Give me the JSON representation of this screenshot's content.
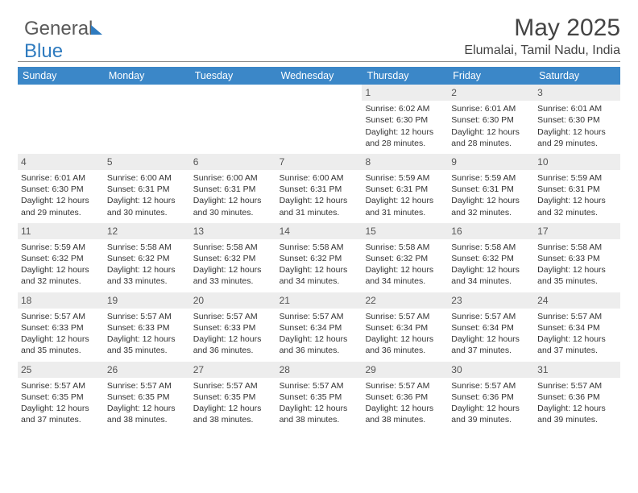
{
  "logo": {
    "part1": "General",
    "part2": "Blue"
  },
  "title": "May 2025",
  "location": "Elumalai, Tamil Nadu, India",
  "dayNames": [
    "Sunday",
    "Monday",
    "Tuesday",
    "Wednesday",
    "Thursday",
    "Friday",
    "Saturday"
  ],
  "labels": {
    "sunrise": "Sunrise: ",
    "sunset": "Sunset: ",
    "daylight": "Daylight: "
  },
  "weeks": [
    [
      null,
      null,
      null,
      null,
      {
        "n": 1,
        "sr": "6:02 AM",
        "ss": "6:30 PM",
        "dl": "12 hours and 28 minutes."
      },
      {
        "n": 2,
        "sr": "6:01 AM",
        "ss": "6:30 PM",
        "dl": "12 hours and 28 minutes."
      },
      {
        "n": 3,
        "sr": "6:01 AM",
        "ss": "6:30 PM",
        "dl": "12 hours and 29 minutes."
      }
    ],
    [
      {
        "n": 4,
        "sr": "6:01 AM",
        "ss": "6:30 PM",
        "dl": "12 hours and 29 minutes."
      },
      {
        "n": 5,
        "sr": "6:00 AM",
        "ss": "6:31 PM",
        "dl": "12 hours and 30 minutes."
      },
      {
        "n": 6,
        "sr": "6:00 AM",
        "ss": "6:31 PM",
        "dl": "12 hours and 30 minutes."
      },
      {
        "n": 7,
        "sr": "6:00 AM",
        "ss": "6:31 PM",
        "dl": "12 hours and 31 minutes."
      },
      {
        "n": 8,
        "sr": "5:59 AM",
        "ss": "6:31 PM",
        "dl": "12 hours and 31 minutes."
      },
      {
        "n": 9,
        "sr": "5:59 AM",
        "ss": "6:31 PM",
        "dl": "12 hours and 32 minutes."
      },
      {
        "n": 10,
        "sr": "5:59 AM",
        "ss": "6:31 PM",
        "dl": "12 hours and 32 minutes."
      }
    ],
    [
      {
        "n": 11,
        "sr": "5:59 AM",
        "ss": "6:32 PM",
        "dl": "12 hours and 32 minutes."
      },
      {
        "n": 12,
        "sr": "5:58 AM",
        "ss": "6:32 PM",
        "dl": "12 hours and 33 minutes."
      },
      {
        "n": 13,
        "sr": "5:58 AM",
        "ss": "6:32 PM",
        "dl": "12 hours and 33 minutes."
      },
      {
        "n": 14,
        "sr": "5:58 AM",
        "ss": "6:32 PM",
        "dl": "12 hours and 34 minutes."
      },
      {
        "n": 15,
        "sr": "5:58 AM",
        "ss": "6:32 PM",
        "dl": "12 hours and 34 minutes."
      },
      {
        "n": 16,
        "sr": "5:58 AM",
        "ss": "6:32 PM",
        "dl": "12 hours and 34 minutes."
      },
      {
        "n": 17,
        "sr": "5:58 AM",
        "ss": "6:33 PM",
        "dl": "12 hours and 35 minutes."
      }
    ],
    [
      {
        "n": 18,
        "sr": "5:57 AM",
        "ss": "6:33 PM",
        "dl": "12 hours and 35 minutes."
      },
      {
        "n": 19,
        "sr": "5:57 AM",
        "ss": "6:33 PM",
        "dl": "12 hours and 35 minutes."
      },
      {
        "n": 20,
        "sr": "5:57 AM",
        "ss": "6:33 PM",
        "dl": "12 hours and 36 minutes."
      },
      {
        "n": 21,
        "sr": "5:57 AM",
        "ss": "6:34 PM",
        "dl": "12 hours and 36 minutes."
      },
      {
        "n": 22,
        "sr": "5:57 AM",
        "ss": "6:34 PM",
        "dl": "12 hours and 36 minutes."
      },
      {
        "n": 23,
        "sr": "5:57 AM",
        "ss": "6:34 PM",
        "dl": "12 hours and 37 minutes."
      },
      {
        "n": 24,
        "sr": "5:57 AM",
        "ss": "6:34 PM",
        "dl": "12 hours and 37 minutes."
      }
    ],
    [
      {
        "n": 25,
        "sr": "5:57 AM",
        "ss": "6:35 PM",
        "dl": "12 hours and 37 minutes."
      },
      {
        "n": 26,
        "sr": "5:57 AM",
        "ss": "6:35 PM",
        "dl": "12 hours and 38 minutes."
      },
      {
        "n": 27,
        "sr": "5:57 AM",
        "ss": "6:35 PM",
        "dl": "12 hours and 38 minutes."
      },
      {
        "n": 28,
        "sr": "5:57 AM",
        "ss": "6:35 PM",
        "dl": "12 hours and 38 minutes."
      },
      {
        "n": 29,
        "sr": "5:57 AM",
        "ss": "6:36 PM",
        "dl": "12 hours and 38 minutes."
      },
      {
        "n": 30,
        "sr": "5:57 AM",
        "ss": "6:36 PM",
        "dl": "12 hours and 39 minutes."
      },
      {
        "n": 31,
        "sr": "5:57 AM",
        "ss": "6:36 PM",
        "dl": "12 hours and 39 minutes."
      }
    ]
  ]
}
